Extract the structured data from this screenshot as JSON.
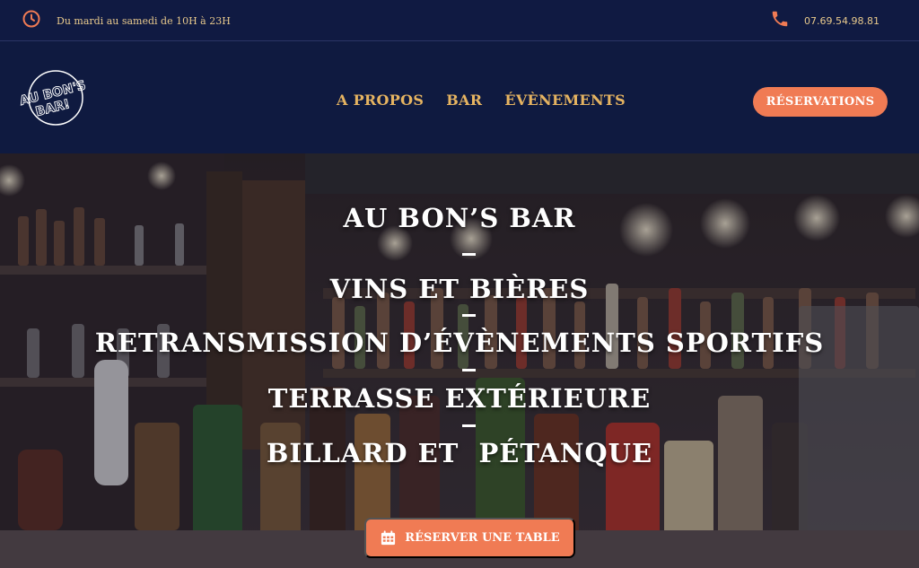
{
  "topbar": {
    "hours": "Du mardi au samedi de 10H à 23H",
    "phone": "07.69.54.98.81"
  },
  "logo": {
    "line1": "AU BON'S",
    "line2": "BAR!"
  },
  "nav": {
    "items": [
      {
        "label": "A PROPOS"
      },
      {
        "label": "BAR"
      },
      {
        "label": "ÉVÈNEMENTS"
      }
    ],
    "cta": "RÉSERVATIONS"
  },
  "hero": {
    "lines": [
      "AU BON’S BAR",
      "VINS ET BIÈRES",
      "RETRANSMISSION D’ÉVÈNEMENTS SPORTIFS",
      "TERRASSE EXTÉRIEURE",
      "BILLARD ET  PÉTANQUE"
    ],
    "cta": "RÉSERVER UNE TABLE"
  },
  "colors": {
    "navy": "#0f1a40",
    "accent": "#f07b54",
    "gold": "#e6b461"
  },
  "icons": [
    "clock-icon",
    "phone-icon",
    "calendar-icon"
  ]
}
